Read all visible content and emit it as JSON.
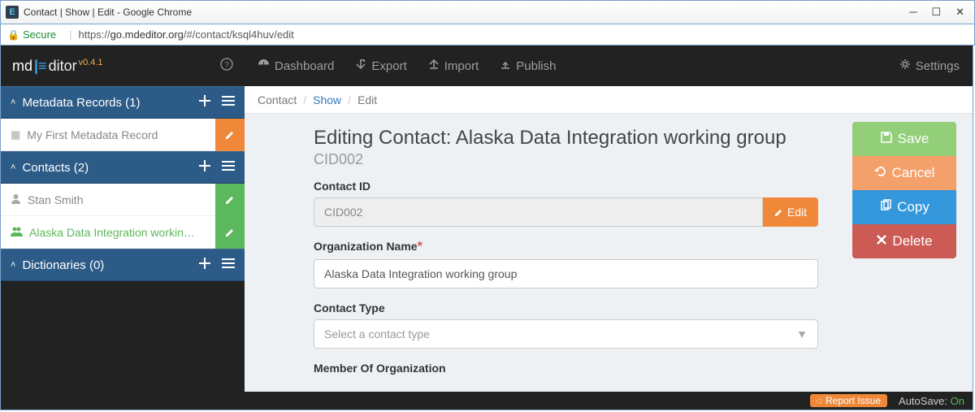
{
  "window": {
    "title": "Contact | Show | Edit - Google Chrome",
    "secure_label": "Secure",
    "url_prefix": "https://",
    "url_host": "go.mdeditor.org",
    "url_path": "/#/contact/ksql4huv/edit"
  },
  "brand": {
    "name_pre": "md",
    "name_post": "ditor",
    "version": "v0.4.1"
  },
  "nav": {
    "dashboard": "Dashboard",
    "export": "Export",
    "import": "Import",
    "publish": "Publish",
    "settings": "Settings"
  },
  "sidebar": {
    "sections": [
      {
        "title": "Metadata Records (1)"
      },
      {
        "title": "Contacts (2)"
      },
      {
        "title": "Dictionaries (0)"
      }
    ],
    "records_item": "My First Metadata Record",
    "contacts": [
      {
        "label": "Stan Smith"
      },
      {
        "label": "Alaska Data Integration working…"
      }
    ]
  },
  "breadcrumbs": {
    "a": "Contact",
    "b": "Show",
    "c": "Edit"
  },
  "page": {
    "heading": "Editing Contact: Alaska Data Integration working group",
    "subheading": "CID002",
    "labels": {
      "contact_id": "Contact ID",
      "org_name": "Organization Name",
      "contact_type": "Contact Type",
      "member_of": "Member Of Organization"
    },
    "values": {
      "contact_id": "CID002",
      "org_name": "Alaska Data Integration working group",
      "contact_type_placeholder": "Select a contact type"
    },
    "editpill": "Edit"
  },
  "actions": {
    "save": "Save",
    "cancel": "Cancel",
    "copy": "Copy",
    "delete": "Delete"
  },
  "footer": {
    "report": "Report Issue",
    "autosave_label": "AutoSave:",
    "autosave_state": "On"
  }
}
